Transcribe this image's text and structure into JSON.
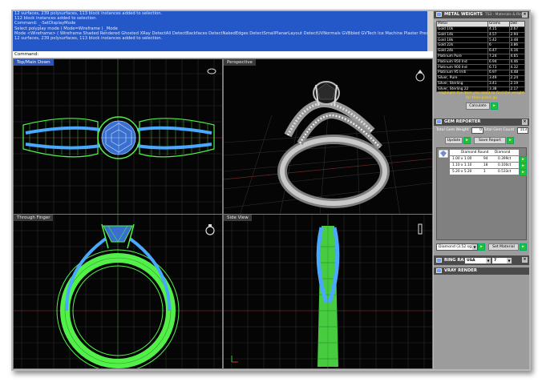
{
  "command_history": {
    "lines": [
      "12 surfaces, 239 polysurfaces, 113 block instances added to selection.",
      "112 block instances added to selection.",
      "Command: _-SetDisplayMode",
      "Select polyplay mode ( Mode=Wireframe ) _Mode",
      "Mode <Wireframe> ( Wireframe Shaded Rendered Ghosted XRay DetectAll DetectBackfaces DetectNakedEdges DetectSmallPlanarLayout DetectUVNormals GVBbled GVTech Ice Machine Plaster Presentation Sl",
      "12 surfaces, 239 polysurfaces, 113 block instances added to selection."
    ],
    "prompt": "Command:"
  },
  "viewports": {
    "top_left": {
      "title": "Top/Main Down"
    },
    "top_right": {
      "title": "Perspective"
    },
    "bottom_left": {
      "title": "Through Finger"
    },
    "bottom_right": {
      "title": "Side View"
    }
  },
  "metal_weights": {
    "title": "METAL WEIGHTS",
    "subtitle": "TS3 - Materials & Ring Weight",
    "columns": [
      "Metal",
      "Grams",
      "Dwt"
    ],
    "rows": [
      [
        "Gold 10k",
        "4.15",
        "2.67"
      ],
      [
        "Gold 14k",
        "4.57",
        "2.94"
      ],
      [
        "Gold 18k",
        "5.42",
        "3.48"
      ],
      [
        "Gold 22k",
        "6",
        "3.86"
      ],
      [
        "Gold 24k",
        "6.47",
        "4.16"
      ],
      [
        "Platinum Pure",
        "7.24",
        "4.65"
      ],
      [
        "Platinum 950 Ind",
        "6.94",
        "4.46"
      ],
      [
        "Platinum 900 Ind",
        "6.73",
        "4.32"
      ],
      [
        "Platinum 95 Iridi",
        "6.97",
        "4.48"
      ],
      [
        "Silver, Pure",
        "3.49",
        "2.24"
      ],
      [
        "Silver, Sterling",
        "3.41",
        "2.19"
      ],
      [
        "Silver, Sterling 22",
        "3.38",
        "2.17"
      ]
    ],
    "hint": "Highlight the item you want to find the weight for then press go",
    "calculate_label": "Calculate"
  },
  "gem_reporter": {
    "title": "GEM REPORTER",
    "total_weight_label": "Total Gem Weight",
    "total_weight_value": "0",
    "total_count_label": "Total Gem Count",
    "total_count_value": "113",
    "update_label": "Update",
    "save_report_label": "Save Report",
    "header_cols": [
      "Diamond Round",
      "Diamond"
    ],
    "gem_rows": [
      [
        "1.00 x 1.00",
        "94",
        "0.399ct"
      ],
      [
        "1.10 x 1.10",
        "18",
        "0.100ct"
      ],
      [
        "5.20 x 5.20",
        "1",
        "0.533ct"
      ]
    ],
    "material_select": "Diamond (3.52 sg)",
    "set_material_label": "Set Material"
  },
  "ring_rail": {
    "title": "RING RAIL",
    "region_select": "USA",
    "size_select": "7"
  },
  "vray": {
    "title": "VRAY RENDER"
  },
  "colors": {
    "wire_green": "#53f04a",
    "wire_blue": "#4aa8ff",
    "metal_silver": "#b7b7b7",
    "grid": "#303030",
    "title_active": "#2c55b8"
  }
}
